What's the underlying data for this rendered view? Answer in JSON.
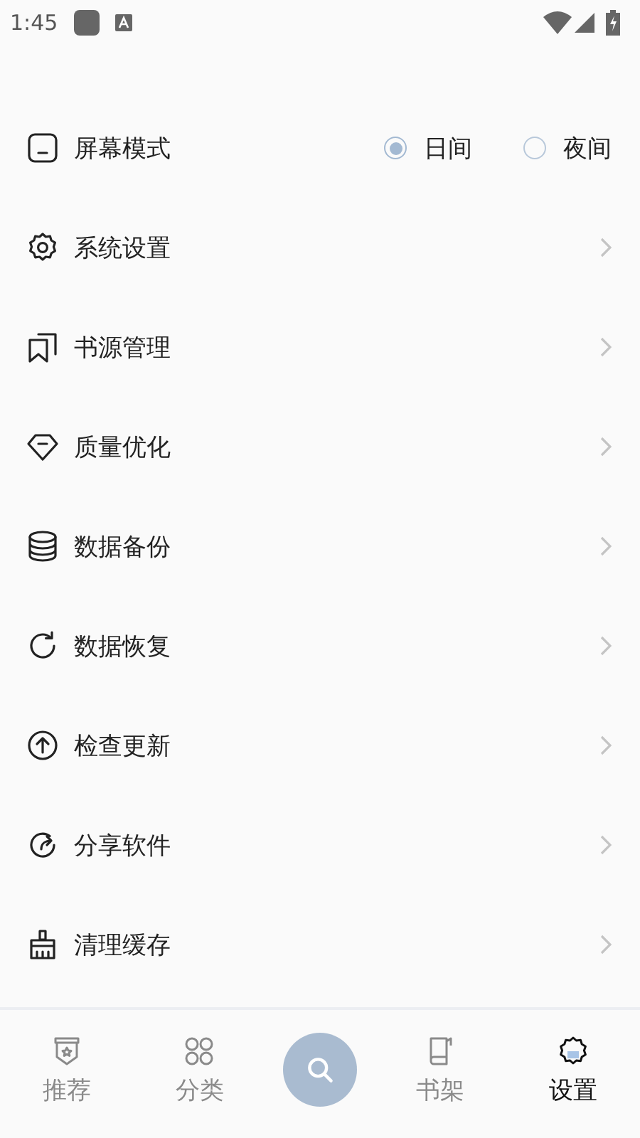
{
  "status_bar": {
    "time": "1:45"
  },
  "screen_mode": {
    "label": "屏幕模式",
    "options": [
      {
        "label": "日间",
        "selected": true
      },
      {
        "label": "夜间",
        "selected": false
      }
    ]
  },
  "menu_items": [
    {
      "label": "系统设置"
    },
    {
      "label": "书源管理"
    },
    {
      "label": "质量优化"
    },
    {
      "label": "数据备份"
    },
    {
      "label": "数据恢复"
    },
    {
      "label": "检查更新"
    },
    {
      "label": "分享软件"
    },
    {
      "label": "清理缓存"
    }
  ],
  "bottom_nav": [
    {
      "kind": "tab",
      "label": "推荐",
      "selected": false
    },
    {
      "kind": "tab",
      "label": "分类",
      "selected": false
    },
    {
      "kind": "search",
      "selected": false
    },
    {
      "kind": "tab",
      "label": "书架",
      "selected": false
    },
    {
      "kind": "tab",
      "label": "设置",
      "selected": true
    }
  ]
}
